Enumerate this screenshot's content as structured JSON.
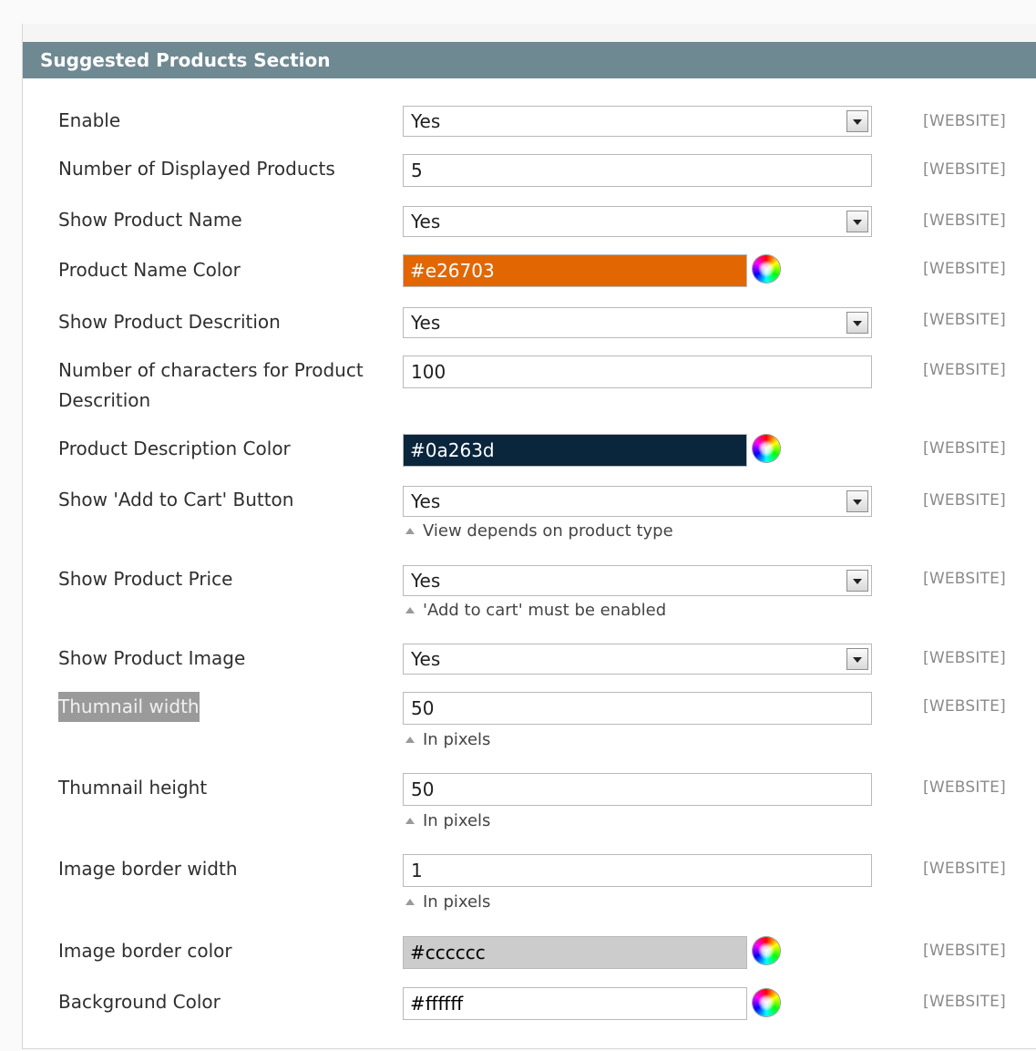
{
  "section": {
    "title": "Suggested Products Section"
  },
  "scope_label": "[WEBSITE]",
  "fields": {
    "enable": {
      "label": "Enable",
      "value": "Yes"
    },
    "num_displayed": {
      "label": "Number of Displayed Products",
      "value": "5"
    },
    "show_name": {
      "label": "Show Product Name",
      "value": "Yes"
    },
    "name_color": {
      "label": "Product Name Color",
      "value": "#e26703",
      "text_color": "#ffffff"
    },
    "show_desc": {
      "label": "Show Product Descrition",
      "value": "Yes"
    },
    "num_chars": {
      "label_line1": "Number of characters for Product",
      "label_line2": "Descrition",
      "value": "100"
    },
    "desc_color": {
      "label": "Product Description Color",
      "value": "#0a263d",
      "text_color": "#ffffff"
    },
    "show_cart": {
      "label": "Show 'Add to Cart' Button",
      "value": "Yes",
      "note": "View depends on product type"
    },
    "show_price": {
      "label": "Show Product Price",
      "value": "Yes",
      "note": "'Add to cart' must be enabled"
    },
    "show_image": {
      "label": "Show Product Image",
      "value": "Yes"
    },
    "thumb_width": {
      "label": "Thumnail width",
      "value": "50",
      "note": "In pixels"
    },
    "thumb_height": {
      "label": "Thumnail height",
      "value": "50",
      "note": "In pixels"
    },
    "border_width": {
      "label": "Image border width",
      "value": "1",
      "note": "In pixels"
    },
    "border_color": {
      "label": "Image border color",
      "value": "#cccccc",
      "text_color": "#000000"
    },
    "bg_color": {
      "label": "Background Color",
      "value": "#ffffff",
      "text_color": "#000000"
    }
  }
}
